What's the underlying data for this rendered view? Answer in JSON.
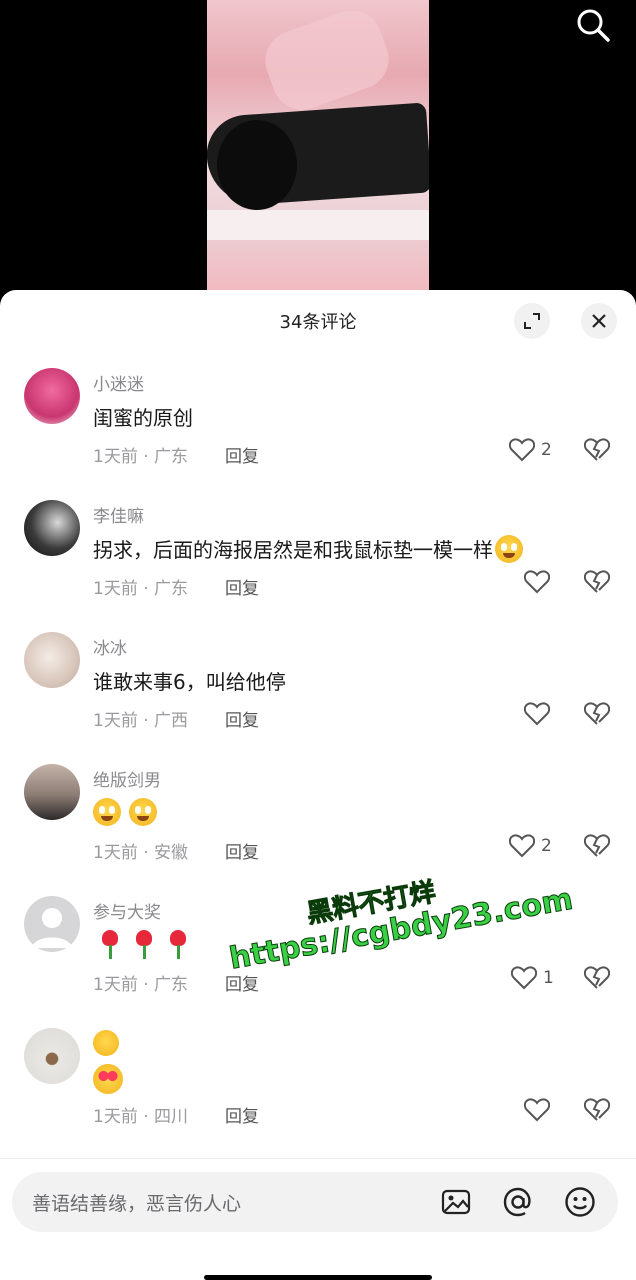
{
  "header": {
    "title": "34条评论",
    "search_icon": "search-icon",
    "expand_icon": "expand-icon",
    "close_icon": "close-icon"
  },
  "comments": [
    {
      "username": "小迷迷",
      "text": "闺蜜的原创",
      "time": "1天前",
      "location": "广东",
      "reply_label": "回复",
      "likes": "2"
    },
    {
      "username": "李佳嘛",
      "text": "拐求，后面的海报居然是和我鼠标垫一模一样",
      "emoji": "grinning-emoji",
      "time": "1天前",
      "location": "广东",
      "reply_label": "回复",
      "likes": ""
    },
    {
      "username": "冰冰",
      "text": "谁敢来事6，叫给他停",
      "time": "1天前",
      "location": "广西",
      "reply_label": "回复",
      "likes": ""
    },
    {
      "username": "绝版剑男",
      "emojis": [
        "grinning-emoji",
        "grinning-emoji"
      ],
      "time": "1天前",
      "location": "安徽",
      "reply_label": "回复",
      "likes": "2"
    },
    {
      "username": "参与大奖",
      "emojis": [
        "rose-emoji",
        "rose-emoji",
        "rose-emoji"
      ],
      "time": "1天前",
      "location": "广东",
      "reply_label": "回复",
      "likes": "1"
    },
    {
      "username": "",
      "emojis": [
        "smirk-emoji",
        "heart-eyes-emoji"
      ],
      "time": "1天前",
      "location": "四川",
      "reply_label": "回复",
      "likes": ""
    }
  ],
  "watermark": {
    "line1": "黑料不打烊",
    "line2": "https://cgbdy23.com"
  },
  "input_bar": {
    "placeholder": "善语结善缘，恶言伤人心",
    "image_icon": "image-icon",
    "mention_icon": "at-icon",
    "emoji_icon": "emoji-icon"
  },
  "colors": {
    "accent_text": "#1a1a1a",
    "muted_text": "#9b9b9f",
    "watermark_green": "#39d046",
    "sheet_bg": "#ffffff",
    "video_bg": "#000000"
  }
}
